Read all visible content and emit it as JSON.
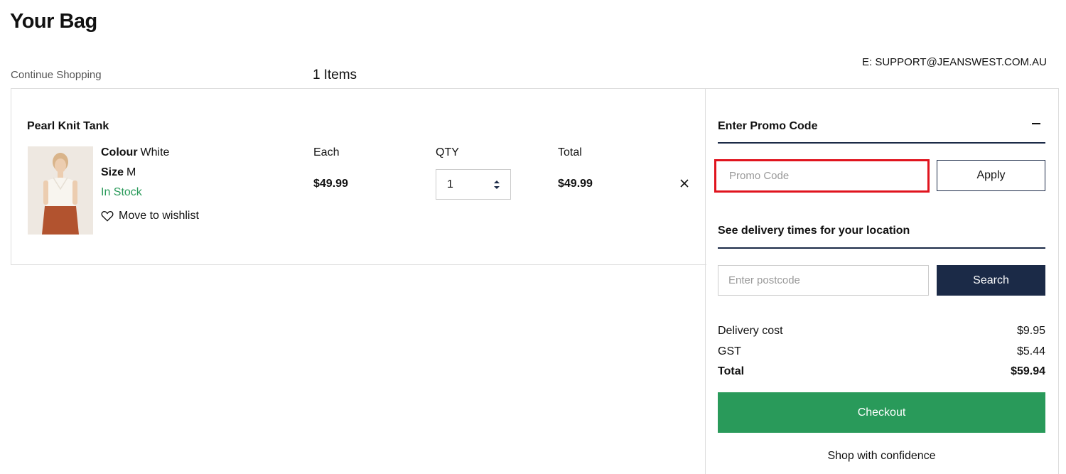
{
  "header": {
    "title": "Your Bag",
    "support_email": "E: SUPPORT@JEANSWEST.COM.AU",
    "continue_label": "Continue Shopping",
    "item_count": "1",
    "item_count_label": "Items"
  },
  "item": {
    "name": "Pearl Knit Tank",
    "colour_label": "Colour",
    "colour_value": "White",
    "size_label": "Size",
    "size_value": "M",
    "stock_status": "In Stock",
    "wishlist_label": "Move to wishlist",
    "each_header": "Each",
    "qty_header": "QTY",
    "total_header": "Total",
    "each_price": "$49.99",
    "quantity": "1",
    "total_price": "$49.99",
    "image_icon": "product-photo"
  },
  "promo": {
    "title": "Enter Promo Code",
    "placeholder": "Promo Code",
    "apply_label": "Apply",
    "collapse_icon": "minus-icon"
  },
  "delivery": {
    "title": "See delivery times for your location",
    "placeholder": "Enter postcode",
    "search_label": "Search"
  },
  "summary": {
    "delivery_label": "Delivery cost",
    "delivery_value": "$9.95",
    "gst_label": "GST",
    "gst_value": "$5.44",
    "total_label": "Total",
    "total_value": "$59.94",
    "checkout_label": "Checkout",
    "confidence_label": "Shop with confidence"
  },
  "colors": {
    "accent_navy": "#1b2a47",
    "checkout_green": "#299a5a",
    "in_stock_green": "#2a9a5a",
    "highlight_red": "#e0141e"
  }
}
